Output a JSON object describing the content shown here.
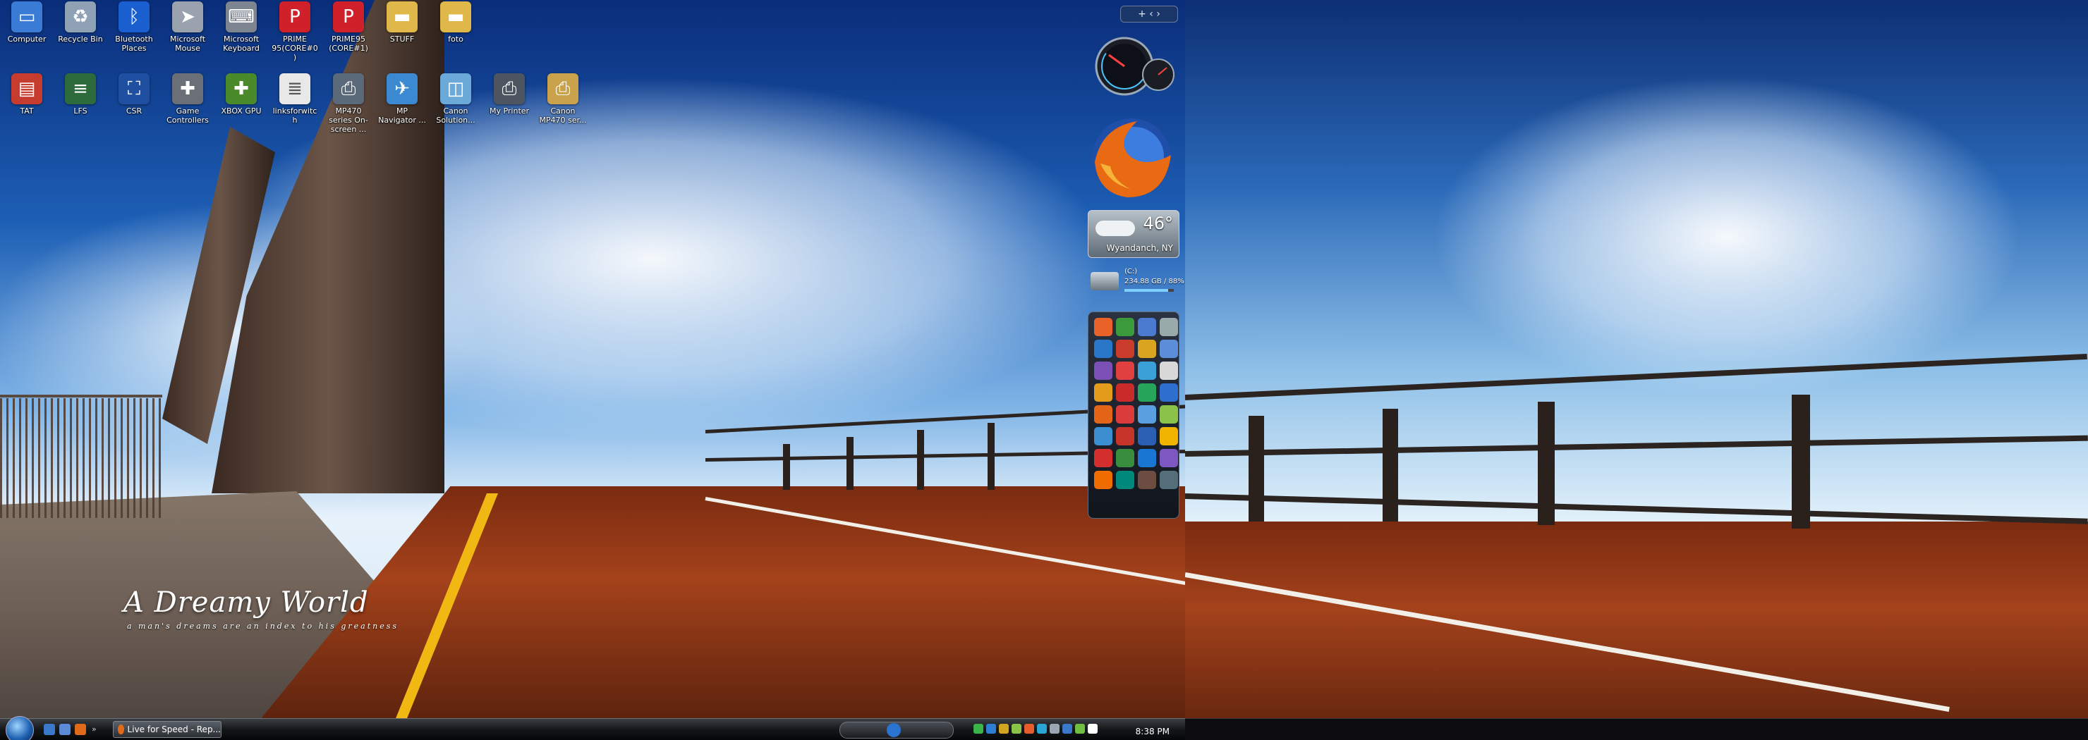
{
  "desktop": {
    "wallpaper_caption": {
      "title": "A Dreamy World",
      "subtitle": "a man's dreams are an index to his greatness"
    },
    "icons_row1": [
      {
        "label": "Computer",
        "icon": "computer-icon",
        "color": "#3a7bd5"
      },
      {
        "label": "Recycle Bin",
        "icon": "recycle-bin-icon",
        "color": "#8fa2b5"
      },
      {
        "label": "Bluetooth Places",
        "icon": "bluetooth-icon",
        "color": "#1a5fcf"
      },
      {
        "label": "Microsoft Mouse",
        "icon": "mouse-icon",
        "color": "#9aa3ad"
      },
      {
        "label": "Microsoft Keyboard",
        "icon": "keyboard-icon",
        "color": "#7c8590"
      },
      {
        "label": "PRIME 95(CORE#0)",
        "icon": "prime95-icon",
        "color": "#d0202a"
      },
      {
        "label": "PRIME95 (CORE#1)",
        "icon": "prime95-icon",
        "color": "#d0202a"
      },
      {
        "label": "STUFF",
        "icon": "folder-icon",
        "color": "#e0b84a"
      },
      {
        "label": "foto",
        "icon": "folder-icon",
        "color": "#e0b84a"
      }
    ],
    "icons_row2": [
      {
        "label": "TAT",
        "icon": "tat-icon",
        "color": "#c63d2f"
      },
      {
        "label": "LFS",
        "icon": "lfs-icon",
        "color": "#2d6a3c"
      },
      {
        "label": "CSR",
        "icon": "csr-icon",
        "color": "#1e4fa0"
      },
      {
        "label": "Game Controllers",
        "icon": "gamepad-icon",
        "color": "#6b7078"
      },
      {
        "label": "XBOX GPU",
        "icon": "xbox-controller-icon",
        "color": "#4a8a2a"
      },
      {
        "label": "linksforwitch",
        "icon": "text-file-icon",
        "color": "#e8e8e8"
      },
      {
        "label": "MP470 series On-screen ...",
        "icon": "printer-manual-icon",
        "color": "#5a6a7a"
      },
      {
        "label": "MP Navigator ...",
        "icon": "mp-navigator-icon",
        "color": "#3b8ad1"
      },
      {
        "label": "Canon Solution...",
        "icon": "canon-solution-icon",
        "color": "#6aa9d8"
      },
      {
        "label": "My Printer",
        "icon": "printer-icon",
        "color": "#4d5560"
      },
      {
        "label": "Canon MP470 ser...",
        "icon": "canon-printer-icon",
        "color": "#c9a24b"
      }
    ]
  },
  "sidebar": {
    "controls": "+ ‹ ›",
    "weather": {
      "temp": "46°",
      "location": "Wyandanch, NY"
    },
    "drive": {
      "label": "(C:)",
      "stats": "234.88 GB / 88%"
    },
    "launcher_colors": [
      "#e8622a",
      "#3b9b3a",
      "#4a7bd1",
      "#9aa",
      "#2a76c9",
      "#c93b2b",
      "#d9a520",
      "#5b8dd8",
      "#7b4fb3",
      "#e04040",
      "#3aa0d8",
      "#d8d8d8",
      "#e39b1c",
      "#c92b2b",
      "#27a55a",
      "#2d6fcf",
      "#e46418",
      "#db3c3c",
      "#5aa0e0",
      "#8bc34a",
      "#3b8fd0",
      "#c7342a",
      "#2b5fb3",
      "#f0b400",
      "#d32f2f",
      "#388e3c",
      "#1976d2",
      "#7e57c2",
      "#ef6c00",
      "#00897b",
      "#6d4c41",
      "#546e7a"
    ]
  },
  "taskbar": {
    "active_task": "Live for Speed - Rep...",
    "clock": "8:38 PM"
  }
}
